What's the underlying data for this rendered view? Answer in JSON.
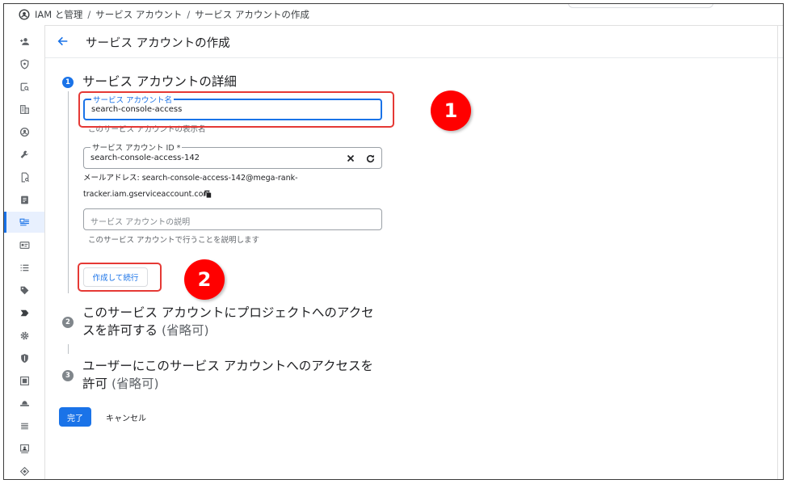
{
  "breadcrumb": {
    "items": [
      "IAM と管理",
      "サービス アカウント",
      "サービス アカウントの作成"
    ],
    "separator": "/"
  },
  "header": {
    "title": "サービス アカウントの作成"
  },
  "sidebar": {
    "items": [
      {
        "icon": "person-add-icon"
      },
      {
        "icon": "shield-icon"
      },
      {
        "icon": "search-account-icon"
      },
      {
        "icon": "building-icon"
      },
      {
        "icon": "account-circle-icon"
      },
      {
        "icon": "wrench-icon"
      },
      {
        "icon": "document-search-icon"
      },
      {
        "icon": "note-icon"
      },
      {
        "icon": "service-account-icon",
        "active": true
      },
      {
        "icon": "id-card-icon"
      },
      {
        "icon": "list-icon"
      },
      {
        "icon": "tag-icon"
      },
      {
        "icon": "label-arrow-icon"
      },
      {
        "icon": "gear-icon"
      },
      {
        "icon": "security-icon"
      },
      {
        "icon": "screen-icon"
      },
      {
        "icon": "hat-icon"
      },
      {
        "icon": "lines-icon"
      },
      {
        "icon": "presentation-icon"
      },
      {
        "icon": "diamond-icon"
      }
    ]
  },
  "steps": [
    {
      "number": "1",
      "title": "サービス アカウントの詳細",
      "optional": ""
    },
    {
      "number": "2",
      "title_line1": "このサービス アカウントにプロジェクトへのアクセ",
      "title_line2": "スを許可する",
      "optional": "(省略可)"
    },
    {
      "number": "3",
      "title_line1": "ユーザーにこのサービス アカウントへのアクセスを",
      "title_line2": "許可",
      "optional": "(省略可)"
    }
  ],
  "form": {
    "name_field": {
      "label": "サービス アカウント名",
      "value": "search-console-access",
      "hint": "このサービス アカウントの表示名"
    },
    "id_field": {
      "label": "サービス アカウント ID *",
      "value": "search-console-access-142"
    },
    "email": {
      "line1": "メールアドレス: search-console-access-142@mega-rank-",
      "line2": "tracker.iam.gserviceaccount.com"
    },
    "description_field": {
      "placeholder": "サービス アカウントの説明",
      "hint": "このサービス アカウントで行うことを説明します"
    },
    "create_continue_label": "作成して続行"
  },
  "actions": {
    "done_label": "完了",
    "cancel_label": "キャンセル"
  },
  "annotations": [
    {
      "label": "1"
    },
    {
      "label": "2"
    }
  ],
  "colors": {
    "accent": "#1a73e8",
    "annotation_red": "#e53935",
    "annotation_circle": "#ff0000"
  }
}
